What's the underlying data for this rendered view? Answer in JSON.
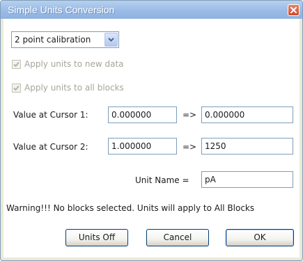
{
  "window": {
    "title": "Simple Units Conversion",
    "close_icon": "close-x-icon"
  },
  "calibration": {
    "selected": "2 point calibration"
  },
  "options": {
    "apply_new_data": {
      "label": "Apply units to new data",
      "checked": true,
      "enabled": false
    },
    "apply_all_blocks": {
      "label": "Apply units to all blocks",
      "checked": true,
      "enabled": false
    }
  },
  "cursor1": {
    "label": "Value at Cursor 1:",
    "value": "0.000000",
    "arrow": "=>",
    "converted": "0.000000"
  },
  "cursor2": {
    "label": "Value at Cursor 2:",
    "value": "1.000000",
    "arrow": "=>",
    "converted": "1250"
  },
  "unit": {
    "label": "Unit Name =",
    "value": "pA"
  },
  "warning": "Warning!!! No blocks selected. Units will apply to All Blocks",
  "buttons": {
    "units_off": "Units Off",
    "cancel": "Cancel",
    "ok": "OK"
  },
  "colors": {
    "titlebar": "#9bbbe6",
    "close_button": "#cc4b2e",
    "input_border": "#7f9db9",
    "disabled_text": "#a5a59b"
  }
}
